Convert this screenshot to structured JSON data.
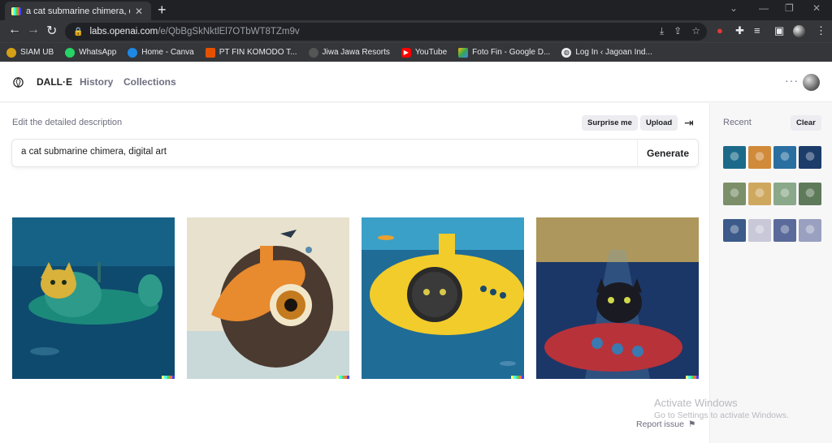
{
  "browser": {
    "tab_title": "a cat submarine chimera, digital a",
    "new_tab": "+",
    "url_host": "labs.openai.com",
    "url_path": "/e/QbBgSkNktlEl7OTbWT8TZm9v",
    "bookmarks": [
      {
        "label": "SIAM UB",
        "color": "#d4a017"
      },
      {
        "label": "WhatsApp",
        "color": "#25d366"
      },
      {
        "label": "Home - Canva",
        "color": "#1e88e5"
      },
      {
        "label": "PT FIN KOMODO T...",
        "color": "#e65100"
      },
      {
        "label": "Jiwa Jawa Resorts",
        "color": "#555555"
      },
      {
        "label": "YouTube",
        "color": "#ff0000"
      },
      {
        "label": "Foto Fin - Google D...",
        "color": "#34a853"
      },
      {
        "label": "Log In ‹ Jagoan Ind...",
        "color": "#e8eaed"
      }
    ]
  },
  "app": {
    "brand": "DALL·E",
    "nav": [
      "History",
      "Collections"
    ],
    "more": "···"
  },
  "editor": {
    "label": "Edit the detailed description",
    "surprise": "Surprise me",
    "upload": "Upload",
    "prompt": "a cat submarine chimera, digital art",
    "generate": "Generate"
  },
  "results": [
    {
      "name": "green submarine cat",
      "bg": "#0f4f74"
    },
    {
      "name": "orange submarine cat",
      "bg": "#e8e2cf"
    },
    {
      "name": "yellow submarine cat",
      "bg": "#1e6b96"
    },
    {
      "name": "red submarine cat",
      "bg": "#1d3b6e"
    }
  ],
  "footer": {
    "report": "Report issue",
    "activate_title": "Activate Windows",
    "activate_sub": "Go to Settings to activate Windows."
  },
  "sidebar": {
    "recent": "Recent",
    "clear": "Clear",
    "thumbs": [
      [
        "#1c6a8a",
        "#d08a3a",
        "#2a6fa0",
        "#1c3c6a"
      ],
      [
        "#7a8f6a",
        "#cfa860",
        "#8aa88a",
        "#5f7a5a"
      ],
      [
        "#3c5a8a",
        "#c8c8d8",
        "#5a6a9a",
        "#9aa0c0"
      ]
    ]
  }
}
